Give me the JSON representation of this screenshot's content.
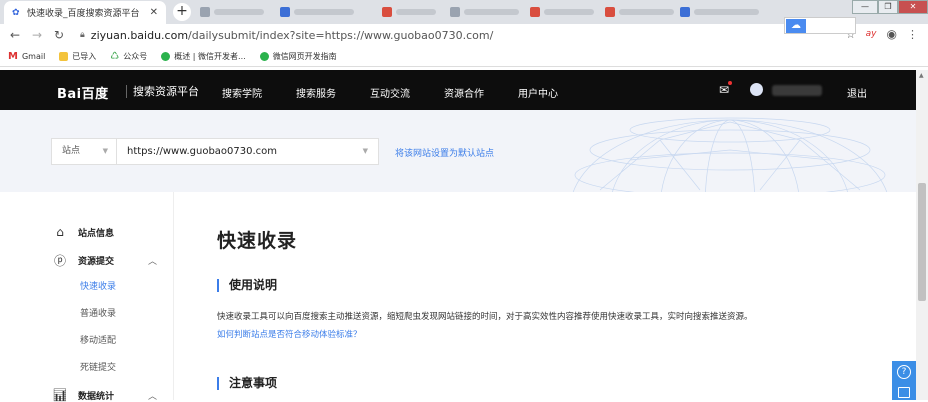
{
  "browser": {
    "active_tab_title": "快速收录_百度搜索资源平台",
    "tab_close": "✕",
    "new_tab": "+",
    "url_host": "ziyuan.baidu.com",
    "url_path": "/dailysubmit/index?site=https://www.guobao0730.com/",
    "bookmarks": [
      "Gmail",
      "已导入",
      "公众号",
      "概述 | 微信开发者...",
      "微信网页开发指南"
    ],
    "ext_label": "ay",
    "colors": {
      "tabbar": "#dee1e6",
      "link": "#3b7de9"
    }
  },
  "header": {
    "logo": "Bai百度",
    "subtitle": "搜索资源平台",
    "nav": [
      "搜索学院",
      "搜索服务",
      "互动交流",
      "资源合作",
      "用户中心"
    ],
    "logout": "退出"
  },
  "banner": {
    "type_select": "站点",
    "site_select": "https://www.guobao0730.com",
    "set_default": "将该网站设置为默认站点"
  },
  "sidebar": {
    "items": [
      {
        "label": "站点信息",
        "icon": "home-icon"
      },
      {
        "label": "资源提交",
        "icon": "submit-icon"
      },
      {
        "label": "数据统计",
        "icon": "stats-icon"
      }
    ],
    "sub": [
      {
        "label": "快速收录",
        "active": true
      },
      {
        "label": "普通收录",
        "active": false
      },
      {
        "label": "移动适配",
        "active": false
      },
      {
        "label": "死链提交",
        "active": false
      }
    ]
  },
  "main": {
    "title": "快速收录",
    "section1": "使用说明",
    "desc": "快速收录工具可以向百度搜索主动推送资源，缩短爬虫发现网站链接的时间，对于高实效性内容推荐使用快速收录工具，实时向搜索推送资源。",
    "link": "如何判断站点是否符合移动体验标准？",
    "section2": "注意事项"
  }
}
